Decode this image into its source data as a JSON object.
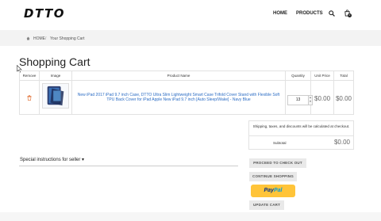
{
  "header": {
    "logo": "DTTO",
    "nav": {
      "home": "HOME",
      "products": "PRODUCTS"
    },
    "cart_count": "0"
  },
  "breadcrumb": {
    "home": "HOME",
    "separator": "/",
    "current": "Your Shopping Cart"
  },
  "page_title": "Shopping Cart",
  "table": {
    "headers": [
      "Remove",
      "Image",
      "Product Name",
      "Quantity",
      "Unit Price",
      "Total"
    ],
    "rows": [
      {
        "product_name": "New iPad 2017 iPad 9.7 inch Case, DTTO Ultra Slim Lightweight Smart Case Trifold Cover Stand with Flexible Soft TPU Back Cover for iPad Apple New iPad 9.7 inch [Auto Sleep/Wake] - Navy Blue",
        "quantity": "13",
        "unit_price": "$0.00",
        "total": "$0.00"
      }
    ]
  },
  "summary": {
    "notice": "Shipping, taxes, and discounts will be calculated at checkout.",
    "subtotal_label": "Subtotal",
    "subtotal_value": "$0.00"
  },
  "instructions_label": "Special instructions for seller ▾",
  "buttons": {
    "checkout": "PROCEED TO CHECK OUT",
    "continue": "CONTINUE SHOPPING",
    "paypal_pay": "Pay",
    "paypal_pal": "Pal",
    "update": "UPDATE CART"
  },
  "colors": {
    "link": "#2b6cc4",
    "paypal_bg": "#ffc439",
    "button_bg": "#e9e9e9"
  }
}
